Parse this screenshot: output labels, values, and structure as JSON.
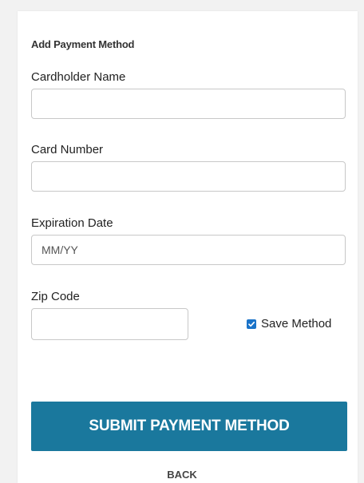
{
  "form": {
    "title": "Add Payment Method",
    "cardholder_name": {
      "label": "Cardholder Name",
      "value": "",
      "placeholder": ""
    },
    "card_number": {
      "label": "Card Number",
      "value": "",
      "placeholder": ""
    },
    "expiration_date": {
      "label": "Expiration Date",
      "value": "",
      "placeholder": "MM/YY"
    },
    "zip_code": {
      "label": "Zip Code",
      "value": "",
      "placeholder": ""
    },
    "save_method": {
      "label": "Save Method",
      "checked": true
    },
    "submit_label": "SUBMIT PAYMENT METHOD",
    "back_label": "BACK"
  },
  "colors": {
    "primary_button": "#1a789d",
    "checkbox": "#1a73c8",
    "background": "#f2f2f2"
  },
  "icons": {
    "checkbox_checked": "checkmark-icon"
  }
}
